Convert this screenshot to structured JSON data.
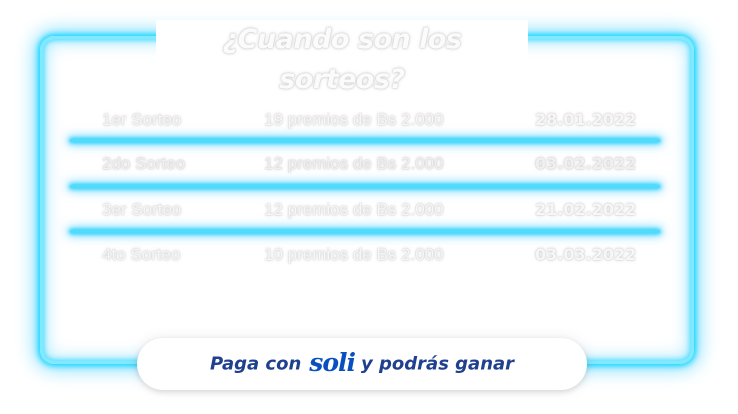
{
  "title": "¿Cuando son los sorteos?",
  "draws": [
    {
      "name": "1er Sorteo",
      "prize": "19 premios de Bs 2.000",
      "date": "28.01.2022"
    },
    {
      "name": "2do Sorteo",
      "prize": "12 premios de Bs 2.000",
      "date": "03.02.2022"
    },
    {
      "name": "3er Sorteo",
      "prize": "12 premios de Bs 2.000",
      "date": "21.02.2022"
    },
    {
      "name": "4to Sorteo",
      "prize": "10 premios de Bs 2.000",
      "date": "03.03.2022"
    }
  ],
  "banner": {
    "prefix": "Paga con",
    "brand": "soli",
    "suffix": "y podrás ganar"
  },
  "colors": {
    "neon": "#00d2ff",
    "banner_text": "#1f3f8f",
    "brand": "#0a4fbf"
  }
}
